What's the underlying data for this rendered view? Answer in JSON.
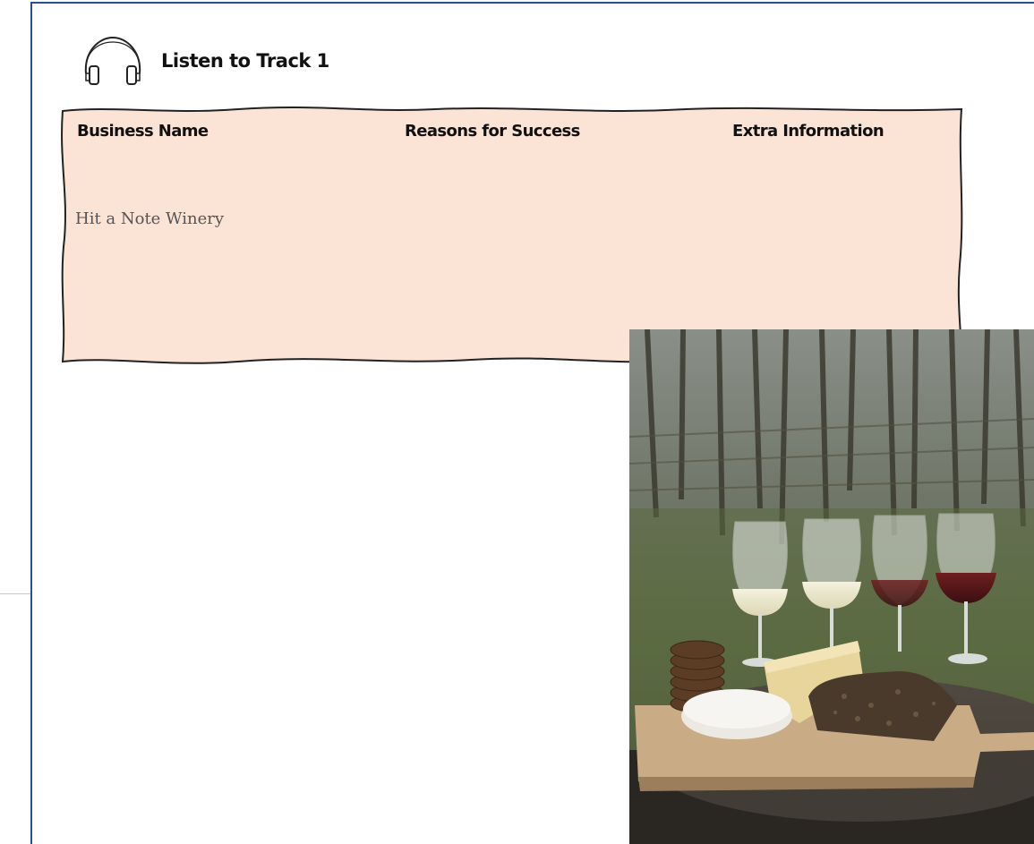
{
  "track": {
    "title": "Listen to Track 1",
    "icon": "headphones-icon"
  },
  "table": {
    "headers": [
      "Business Name",
      "Reasons for Success",
      "Extra Information"
    ],
    "rows": [
      {
        "business_name": "Hit a Note Winery",
        "reasons": "",
        "extra": ""
      }
    ],
    "background_color": "#fbe3d6"
  },
  "photo": {
    "description_icon": "vineyard-wine-cheese-photo"
  },
  "colors": {
    "frame_border": "#2e4f86"
  }
}
